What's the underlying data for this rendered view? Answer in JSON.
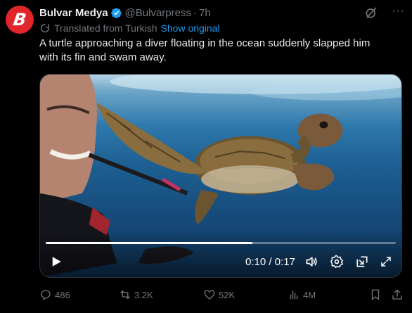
{
  "post": {
    "display_name": "Bulvar Medya",
    "handle": "@Bulvarpress",
    "separator": "·",
    "time": "7h",
    "avatar_letter": "B",
    "translated_note": "Translated from Turkish",
    "show_original": "Show original",
    "text_line1": "A turtle approaching a diver floating in the ocean suddenly slapped him",
    "text_line2": "with its fin and swam away.",
    "more_label": "···"
  },
  "video": {
    "time_display": "0:10 / 0:17",
    "progress": 0.59
  },
  "actions": {
    "replies": "486",
    "reposts": "3.2K",
    "likes": "52K",
    "views": "4M"
  },
  "colors": {
    "accent": "#1d9bf0",
    "avatar_bg": "#e0252b",
    "muted": "#71767b",
    "text": "#e7e9ea",
    "background": "#000000"
  },
  "icons": [
    "verified-badge-icon",
    "grok-icon",
    "more-icon",
    "translate-icon",
    "play-icon",
    "volume-icon",
    "settings-icon",
    "pip-icon",
    "fullscreen-icon",
    "reply-icon",
    "repost-icon",
    "like-icon",
    "views-icon",
    "bookmark-icon",
    "share-icon"
  ]
}
